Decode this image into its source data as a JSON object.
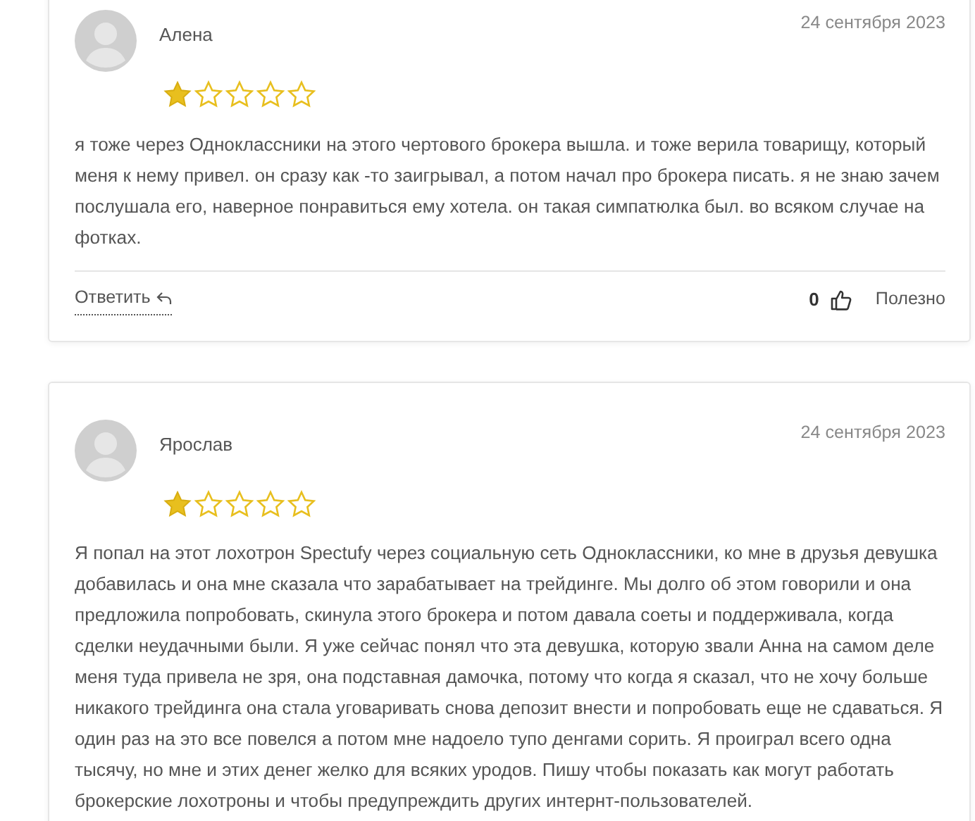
{
  "reviews": [
    {
      "author": "Алена",
      "date": "24 сентября 2023",
      "stars": 1,
      "text": "я тоже через Одноклассники на этого чертового брокера вышла. и тоже верила товарищу, который меня к нему привел. он сразу как -то заигрывал, а потом начал про брокера писать. я не знаю зачем послушала его, наверное понравиться ему хотела. он такая симпатюлка был. во всяком случае на фотках.",
      "footer": {
        "reply": "Ответить",
        "likes": "0",
        "helpful": "Полезно"
      }
    },
    {
      "author": "Ярослав",
      "date": "24 сентября 2023",
      "stars": 1,
      "text": "Я попал на этот лохотрон Spectufy через социальную сеть Одноклассники, ко мне в друзья девушка добавилась и она мне сказала что зарабатывает на трейдинге. Мы долго об этом говорили и она предложила попробовать, скинула этого брокера и потом давала соеты и поддерживала, когда сделки неудачными были. Я уже сейчас понял что эта девушка, которую звали Анна на самом деле меня туда привела не зря, она подставная дамочка, потому что когда я сказал, что не хочу больше никакого трейдинга она стала уговаривать снова депозит внести и попробовать еще не сдаваться. Я один раз на это все повелся а потом мне надоело тупо денгами сорить. Я проиграл всего одна тысячу, но мне и этих денег желко для всяких уродов. Пишу чтобы показать как могут работать брокерские лохотроны и чтобы предупреждить других интернт-пользователей."
    }
  ]
}
